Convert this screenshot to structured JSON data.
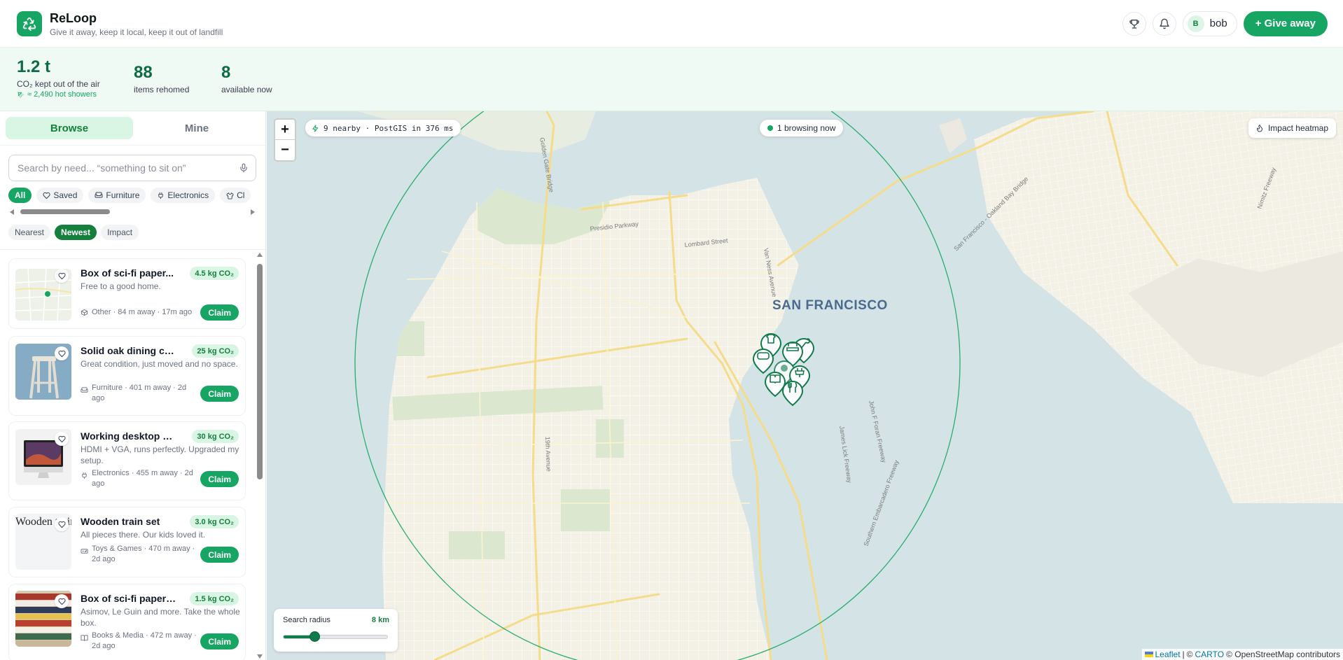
{
  "header": {
    "title": "ReLoop",
    "subtitle": "Give it away, keep it local, keep it out of landfill",
    "user_initial": "B",
    "user_name": "bob",
    "give_button": "+ Give away",
    "brand_color": "#16a562"
  },
  "stats": {
    "co2_value": "1.2 t",
    "co2_label": "CO₂ kept out of the air",
    "co2_equiv": "≈ 2,490 hot showers",
    "rehomed_value": "88",
    "rehomed_label": "items rehomed",
    "available_value": "8",
    "available_label": "available now"
  },
  "sidebar": {
    "tabs": [
      "Browse",
      "Mine"
    ],
    "active_tab": "Browse",
    "search_placeholder": "Search by need... “something to sit on”",
    "filters": [
      {
        "label": "All",
        "icon": null,
        "active": true
      },
      {
        "label": "Saved",
        "icon": "heart-icon",
        "active": false
      },
      {
        "label": "Furniture",
        "icon": "sofa-icon",
        "active": false
      },
      {
        "label": "Electronics",
        "icon": "plug-icon",
        "active": false
      },
      {
        "label": "Cl",
        "icon": "shirt-icon",
        "active": false
      }
    ],
    "sorts": [
      "Nearest",
      "Newest",
      "Impact"
    ],
    "active_sort": "Newest",
    "items": [
      {
        "title": "Box of sci-fi paper...",
        "co2": "4.5 kg CO₂",
        "desc": "Free to a good home.",
        "meta": "Other · 84 m away · 17m ago",
        "category_icon": "box-icon",
        "thumb": "map",
        "claim": "Claim"
      },
      {
        "title": "Solid oak dining cha...",
        "co2": "25 kg CO₂",
        "desc": "Great condition, just moved and no space.",
        "meta": "Furniture · 401 m away · 2d ago",
        "category_icon": "sofa-icon",
        "thumb": "stool",
        "claim": "Claim"
      },
      {
        "title": "Working desktop m...",
        "co2": "30 kg CO₂",
        "desc": "HDMI + VGA, runs perfectly. Upgraded my setup.",
        "meta": "Electronics · 455 m away · 2d ago",
        "category_icon": "plug-icon",
        "thumb": "monitor",
        "claim": "Claim"
      },
      {
        "title": "Wooden train set",
        "co2": "3.0 kg CO₂",
        "desc": "All pieces there. Our kids loved it.",
        "meta": "Toys & Games · 470 m away · 2d ago",
        "category_icon": "gamepad-icon",
        "thumb": "broken",
        "thumb_alt": "Wooden train set",
        "claim": "Claim"
      },
      {
        "title": "Box of sci-fi paperb...",
        "co2": "1.5 kg CO₂",
        "desc": "Asimov, Le Guin and more. Take the whole box.",
        "meta": "Books & Media · 472 m away · 2d ago",
        "category_icon": "book-icon",
        "thumb": "books",
        "claim": "Claim"
      }
    ]
  },
  "map": {
    "nearby_status": "9 nearby · PostGIS in 376 ms",
    "browsing_now": "1 browsing now",
    "heatmap_button": "Impact heatmap",
    "city_label": "SAN FRANCISCO",
    "radius_label": "Search radius",
    "radius_value": "8 km",
    "radius_fraction": 0.3,
    "zoom_in": "+",
    "zoom_out": "−",
    "street_labels": [
      "Golden Gate Bridge",
      "Presidio Parkway",
      "Lombard Street",
      "Van Ness Avenue",
      "San Francisco - Oakland Bay Bridge",
      "19th Avenue",
      "John F Foran Freeway",
      "James Lick Freeway",
      "Southern Embarcadero Freeway",
      "Nimitz Freeway"
    ],
    "attribution": {
      "leaflet": "Leaflet",
      "sep": "|",
      "copy1": "©",
      "carto": "CARTO",
      "osm": "© OpenStreetMap contributors"
    },
    "water_color": "#d4e4e6",
    "land_color": "#f3f1e6"
  }
}
